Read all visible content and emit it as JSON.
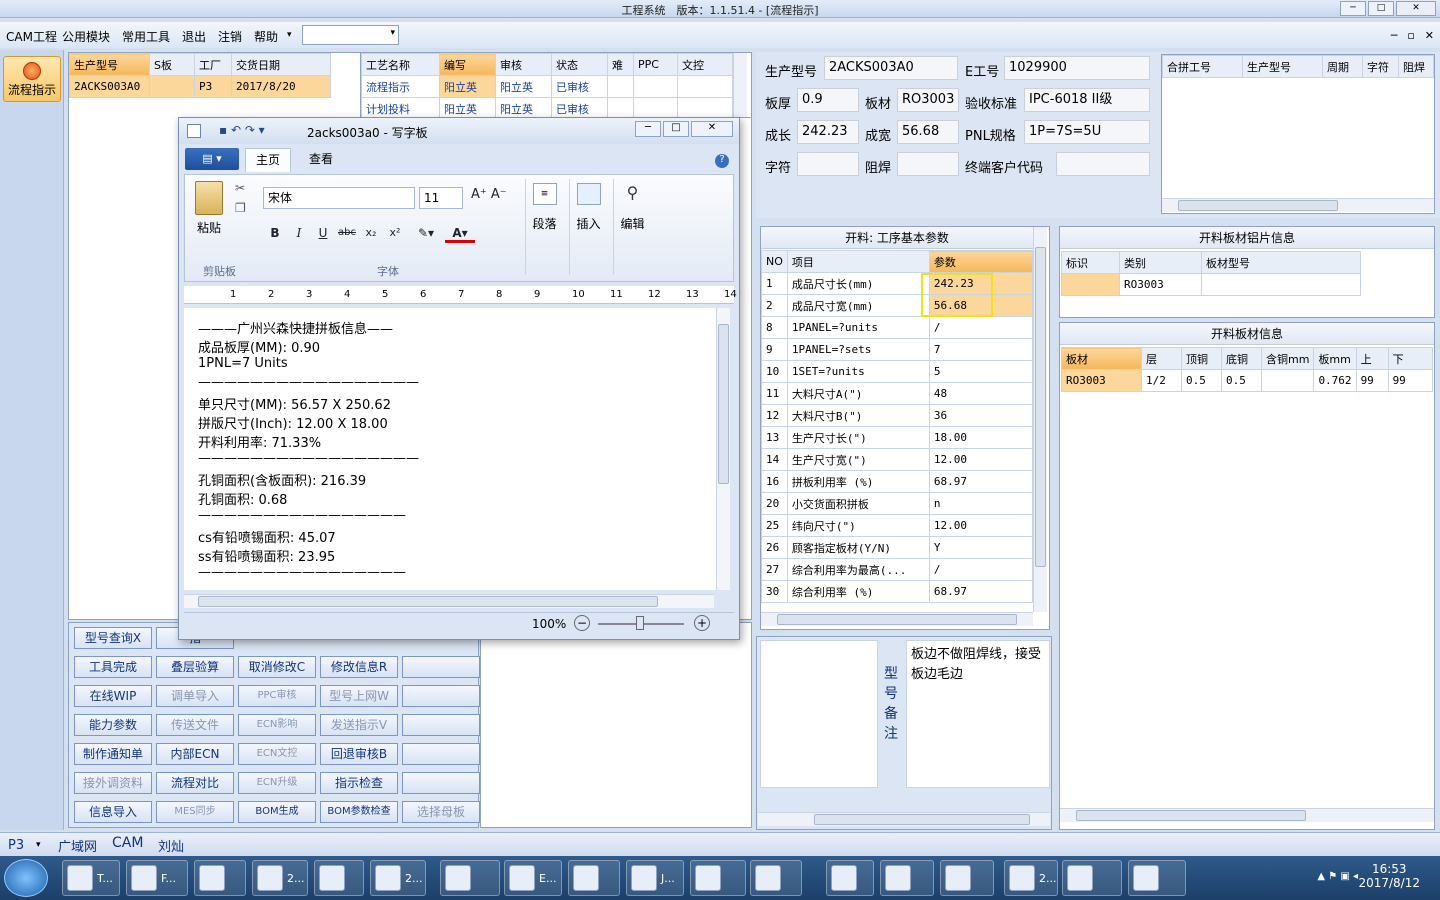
{
  "title_bar": {
    "title": "工程系统　版本：1.1.51.4 - [流程指示]",
    "min": "─",
    "max": "□",
    "close": "✕"
  },
  "menu": {
    "items": [
      "CAM工程",
      "公用模块",
      "常用工具",
      "退出",
      "注销",
      "帮助"
    ],
    "help_arrow": "▾",
    "mdi": [
      "─",
      "▫",
      "✕"
    ]
  },
  "left": {
    "flow_btn": "流程指示"
  },
  "job_grid": {
    "headers": [
      "生产型号",
      "S板",
      "工厂",
      "交货日期"
    ],
    "row": [
      "2ACKS003A0",
      "",
      "P3",
      "2017/8/20"
    ]
  },
  "proc_grid": {
    "headers": [
      "工艺名称",
      "编写",
      "审核",
      "状态",
      "难",
      "PPC",
      "文控"
    ],
    "rows": [
      [
        "流程指示",
        "阳立英",
        "阳立英",
        "已审核",
        "",
        "",
        ""
      ],
      [
        "计划投料",
        "阳立英",
        "阳立英",
        "已审核",
        "",
        "",
        ""
      ]
    ]
  },
  "buttons": [
    [
      "型号查询X",
      "指",
      "",
      "",
      "",
      ""
    ],
    [
      "工具完成",
      "叠层验算",
      "取消修改C",
      "修改信息R",
      ""
    ],
    [
      "在线WIP",
      "调单导入",
      "PPC审核",
      "型号上网W",
      ""
    ],
    [
      "能力参数",
      "传送文件",
      "ECN影响",
      "发送指示V",
      ""
    ],
    [
      "制作通知单",
      "内部ECN",
      "ECN文控",
      "回退审核B",
      ""
    ],
    [
      "接外调资料",
      "流程对比",
      "ECN升级",
      "指示检查",
      ""
    ],
    [
      "信息导入",
      "MES同步",
      "BOM生成",
      "BOM参数检查",
      "选择母板"
    ]
  ],
  "info": {
    "prod_label": "生产型号",
    "prod": "2ACKS003A0",
    "e_label": "E工号",
    "e": "1029900",
    "thick_label": "板厚",
    "thick": "0.9",
    "mat_label": "板材",
    "mat": "RO3003",
    "std_label": "验收标准",
    "std": "IPC-6018 II级",
    "len_label": "成长",
    "len": "242.23",
    "wid_label": "成宽",
    "wid": "56.68",
    "pnl_label": "PNL规格",
    "pnl": "1P=7S=5U",
    "char_label": "字符",
    "char": "",
    "mask_label": "阻焊",
    "mask": "",
    "cust_label": "终端客户代码",
    "cust": ""
  },
  "merge_grid": {
    "headers": [
      "合拼工号",
      "生产型号",
      "周期",
      "字符",
      "阻焊"
    ]
  },
  "params": {
    "title": "开料: 工序基本参数",
    "headers": [
      "NO",
      "项目",
      "参数"
    ],
    "rows": [
      [
        "1",
        "成品尺寸长(mm)",
        "242.23"
      ],
      [
        "2",
        "成品尺寸宽(mm)",
        "56.68"
      ],
      [
        "8",
        "1PANEL=?units",
        "/"
      ],
      [
        "9",
        "1PANEL=?sets",
        "7"
      ],
      [
        "10",
        "1SET=?units",
        "5"
      ],
      [
        "11",
        "大料尺寸A(\")",
        "48"
      ],
      [
        "12",
        "大料尺寸B(\")",
        "36"
      ],
      [
        "13",
        "生产尺寸长(\")",
        "18.00"
      ],
      [
        "14",
        "生产尺寸宽(\")",
        "12.00"
      ],
      [
        "16",
        "拼板利用率 (%)",
        "68.97"
      ],
      [
        "20",
        "小交货面积拼板",
        "n"
      ],
      [
        "25",
        "纬向尺寸(\")",
        "12.00"
      ],
      [
        "26",
        "顾客指定板材(Y/N)",
        "Y"
      ],
      [
        "27",
        "综合利用率为最高(...",
        "/"
      ],
      [
        "30",
        "综合利用率 (%)",
        "68.97"
      ]
    ]
  },
  "foil": {
    "title": "开料板材铝片信息",
    "headers": [
      "标识",
      "类别",
      "板材型号"
    ],
    "row": [
      "",
      "RO3003",
      ""
    ]
  },
  "board": {
    "title": "开料板材信息",
    "headers": [
      "板材",
      "层",
      "顶铜",
      "底铜",
      "含铜mm",
      "板mm",
      "上",
      "下"
    ],
    "row": [
      "RO3003",
      "1/2",
      "0.5",
      "0.5",
      "",
      "0.762",
      "99",
      "99"
    ]
  },
  "remark": {
    "label": "型号备注",
    "text": "板边不做阻焊线，接受板边毛边"
  },
  "status": {
    "site": "P3",
    "net": "广域网",
    "cam": "CAM",
    "user": "刘灿"
  },
  "wordpad": {
    "title": "2acks003a0 - 写字板",
    "tabs": [
      "主页",
      "查看"
    ],
    "font": "宋体",
    "size": "11",
    "groups": {
      "clip": "剪贴板",
      "font": "字体",
      "para": "段落",
      "insert": "插入",
      "edit": "编辑",
      "paste": "粘贴"
    },
    "zoom": "100%",
    "lines": [
      "———广州兴森快捷拼板信息——",
      "成品板厚(MM): 0.90",
      "1PNL=7 Units",
      "—————————————————",
      "单只尺寸(MM): 56.57 X 250.62",
      "拼版尺寸(Inch): 12.00 X 18.00",
      "开料利用率: 71.33%",
      "—————————————————",
      "孔铜面积(含板面积): 216.39",
      "孔铜面积: 0.68",
      "————————————————",
      "cs有铅喷锡面积: 45.07",
      "ss有铅喷锡面积: 23.95",
      "————————————————"
    ],
    "ruler": [
      "1",
      "2",
      "3",
      "4",
      "5",
      "6",
      "7",
      "8",
      "9",
      "10",
      "11",
      "12",
      "13",
      "14"
    ]
  },
  "taskbar": {
    "time": "16:53",
    "date": "2017/8/12",
    "items": [
      "T...",
      "F...",
      "",
      "2...",
      "",
      "2...",
      "",
      "E...",
      "",
      "J...",
      "",
      "",
      "",
      "",
      "",
      "2...",
      "",
      ""
    ]
  }
}
